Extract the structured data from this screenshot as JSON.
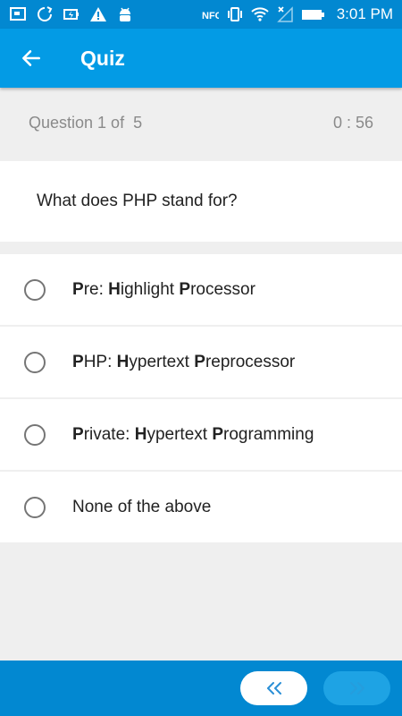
{
  "status_bar": {
    "time": "3:01 PM",
    "left_icons": [
      "screen-icon",
      "sync-icon",
      "battery-saver-icon",
      "warning-icon",
      "android-icon"
    ],
    "right_icons": [
      "nfc-icon",
      "vibrate-icon",
      "wifi-icon",
      "no-signal-icon",
      "battery-icon"
    ]
  },
  "app_bar": {
    "title": "Quiz",
    "back_icon": "arrow-left-icon",
    "color": "#039be5"
  },
  "quiz": {
    "progress": "Question 1 of  5",
    "timer": "0 : 56",
    "question": "What does PHP stand for?",
    "options": [
      {
        "parts": [
          {
            "b": "P"
          },
          {
            "t": "re: "
          },
          {
            "b": "H"
          },
          {
            "t": "ighlight "
          },
          {
            "b": "P"
          },
          {
            "t": "rocessor"
          }
        ]
      },
      {
        "parts": [
          {
            "b": "P"
          },
          {
            "t": "HP: "
          },
          {
            "b": "H"
          },
          {
            "t": "ypertext "
          },
          {
            "b": "P"
          },
          {
            "t": "reprocessor"
          }
        ]
      },
      {
        "parts": [
          {
            "b": "P"
          },
          {
            "t": "rivate: "
          },
          {
            "b": "H"
          },
          {
            "t": "ypertext "
          },
          {
            "b": "P"
          },
          {
            "t": "rogramming"
          }
        ]
      },
      {
        "parts": [
          {
            "t": "None of the above"
          }
        ]
      }
    ]
  },
  "navigation": {
    "prev_icon": "double-chevron-left-icon",
    "next_icon": "double-chevron-right-icon",
    "bar_color": "#0288d1"
  }
}
